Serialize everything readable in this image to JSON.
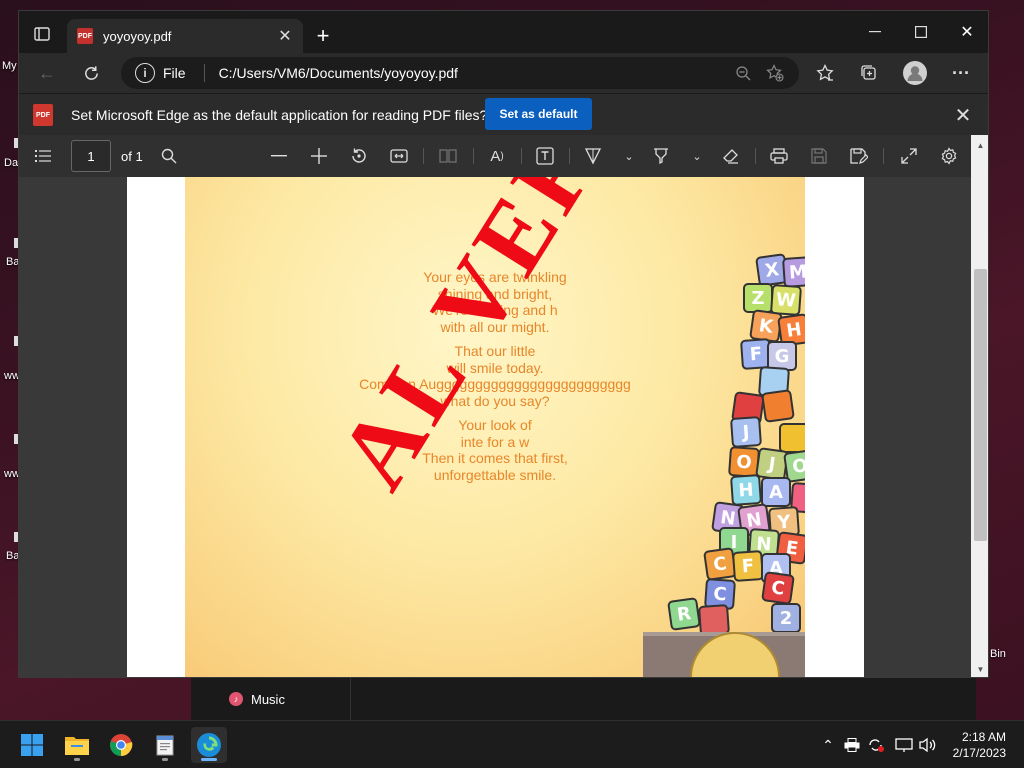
{
  "desktop": {
    "labels_left": [
      "My",
      "Da",
      "Ba",
      "ww",
      "ww",
      "Ba"
    ],
    "label_right": "Bin"
  },
  "tab": {
    "title": "yoyoyoy.pdf",
    "favicon_text": "PDF"
  },
  "address": {
    "scheme": "File",
    "url": "C:/Users/VM6/Documents/yoyoyoy.pdf"
  },
  "infobar": {
    "text": "Set Microsoft Edge as the default application for reading PDF files?",
    "button": "Set as default"
  },
  "pdf_toolbar": {
    "page_value": "1",
    "page_of": "of 1"
  },
  "document": {
    "poem_stanzas": [
      [
        "Your eyes are twinkling",
        "shining and bright,",
        "We're wishing and h",
        "with all our might."
      ],
      [
        "That our little",
        "will smile today.",
        "Come on Auggggggggggggggggggggggggg",
        "what do you say?"
      ],
      [
        "Your look of",
        "inte for a w",
        "Then it comes that first,",
        "unforgettable smile."
      ]
    ],
    "watermark": "AL VERSIO",
    "blocks": [
      {
        "l": "X",
        "c": "#9fa9e8"
      },
      {
        "l": "M",
        "c": "#b79be0"
      },
      {
        "l": "Z",
        "c": "#b7e06a"
      },
      {
        "l": "W",
        "c": "#d8e06a"
      },
      {
        "l": "K",
        "c": "#f7a25a"
      },
      {
        "l": "H",
        "c": "#f77f3a"
      },
      {
        "l": "F",
        "c": "#9fb2f0"
      },
      {
        "l": "G",
        "c": "#c7c7e8"
      },
      {
        "l": "",
        "c": "#a8d0f0"
      },
      {
        "l": "",
        "c": "#e04040"
      },
      {
        "l": "",
        "c": "#f08030"
      },
      {
        "l": "J",
        "c": "#a8c0f0"
      },
      {
        "l": "",
        "c": "#f0c030"
      },
      {
        "l": "O",
        "c": "#f09030"
      },
      {
        "l": "J",
        "c": "#c0d080"
      },
      {
        "l": "O",
        "c": "#a0d890"
      },
      {
        "l": "H",
        "c": "#8fd8e8"
      },
      {
        "l": "A",
        "c": "#a8b8f0"
      },
      {
        "l": "",
        "c": "#f06080"
      },
      {
        "l": "N",
        "c": "#c0a0e0"
      },
      {
        "l": "N",
        "c": "#e0a0d0"
      },
      {
        "l": "Y",
        "c": "#f0c080"
      },
      {
        "l": "I",
        "c": "#90d890"
      },
      {
        "l": "N",
        "c": "#c0e090"
      },
      {
        "l": "E",
        "c": "#f06040"
      },
      {
        "l": "C",
        "c": "#f0a040"
      },
      {
        "l": "F",
        "c": "#f0c040"
      },
      {
        "l": "A",
        "c": "#b0c0f0"
      },
      {
        "l": "C",
        "c": "#8090e0"
      },
      {
        "l": "C",
        "c": "#e04040"
      },
      {
        "l": "R",
        "c": "#90d890"
      },
      {
        "l": "",
        "c": "#e06060"
      },
      {
        "l": "2",
        "c": "#a0b0e0"
      }
    ]
  },
  "underlying_app": {
    "item": "Music"
  },
  "taskbar": {
    "apps": [
      "start-icon",
      "file-explorer-icon",
      "chrome-icon",
      "notepad-icon",
      "edge-icon"
    ],
    "clock_time": "2:18 AM",
    "clock_date": "2/17/2023"
  }
}
